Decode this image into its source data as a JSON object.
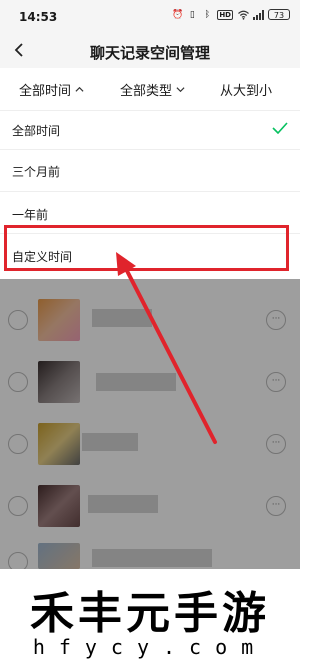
{
  "status_bar": {
    "time": "14:53",
    "battery": "73",
    "icons": [
      "alarm-icon",
      "vibrate-icon",
      "bluetooth-icon",
      "hd-icon",
      "wifi-icon",
      "signal-icon",
      "battery-icon"
    ],
    "hd_label": "HD"
  },
  "nav": {
    "title": "聊天记录空间管理",
    "back_icon": "back-arrow-icon"
  },
  "filters": [
    {
      "label": "全部时间",
      "state": "expanded"
    },
    {
      "label": "全部类型",
      "state": "collapsed"
    },
    {
      "label": "从大到小",
      "state": "collapsed"
    }
  ],
  "dropdown": {
    "options": [
      {
        "label": "全部时间",
        "selected": true
      },
      {
        "label": "三个月前",
        "selected": false
      },
      {
        "label": "一年前",
        "selected": false
      },
      {
        "label": "自定义时间",
        "selected": false
      }
    ]
  },
  "colors": {
    "accent_check": "#07c160",
    "highlight": "#e0242c"
  },
  "watermark": {
    "brand": "禾丰元手游",
    "domain": "hfycy.com"
  }
}
